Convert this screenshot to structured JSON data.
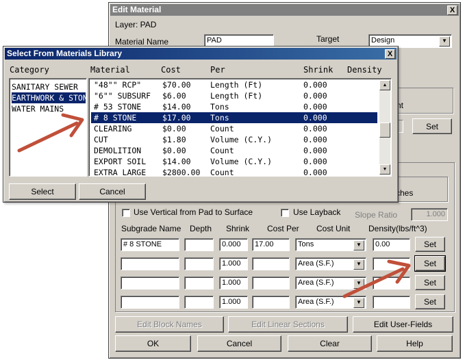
{
  "edit_dialog": {
    "title": "Edit Material",
    "close_glyph": "X",
    "layer_label": "Layer: PAD",
    "material_name_label": "Material Name",
    "material_name_value": "PAD",
    "target_label": "Target",
    "target_value": "Design",
    "partial_label_1": "nt",
    "set_label": "Set",
    "partial_label_2": "ches",
    "use_vertical_label": "Use Vertical from Pad to Surface",
    "use_layback_label": "Use Layback",
    "slope_ratio_label": "Slope Ratio",
    "slope_ratio_value": "1.000",
    "subgrade_headers": {
      "name": "Subgrade Name",
      "depth": "Depth",
      "shrink": "Shrink",
      "cost_per": "Cost Per",
      "cost_unit": "Cost Unit",
      "density": "Density(lbs/ft^3)"
    },
    "subgrade_rows": [
      {
        "name": "# 8 STONE",
        "depth": "",
        "shrink": "0.000",
        "cost": "17.00",
        "unit": "Tons",
        "density": "0.00",
        "set": "Set"
      },
      {
        "name": "",
        "depth": "",
        "shrink": "1.000",
        "cost": "",
        "unit": "Area (S.F.)",
        "density": "",
        "set": "Set"
      },
      {
        "name": "",
        "depth": "",
        "shrink": "1.000",
        "cost": "",
        "unit": "Area (S.F.)",
        "density": "",
        "set": "Set"
      },
      {
        "name": "",
        "depth": "",
        "shrink": "1.000",
        "cost": "",
        "unit": "Area (S.F.)",
        "density": "",
        "set": "Set"
      }
    ],
    "edit_block_names": "Edit Block Names",
    "edit_linear_sections": "Edit Linear Sections",
    "edit_user_fields": "Edit User-Fields",
    "ok": "OK",
    "cancel": "Cancel",
    "clear": "Clear",
    "help": "Help"
  },
  "library_dialog": {
    "title": "Select From Materials Library",
    "close_glyph": "X",
    "headers": {
      "category": "Category",
      "material": "Material",
      "cost": "Cost",
      "per": "Per",
      "shrink": "Shrink",
      "density": "Density"
    },
    "categories": [
      "SANITARY SEWER",
      "EARTHWORK & STONE",
      "WATER MAINS"
    ],
    "materials": [
      {
        "material": "\"48\"\" RCP\"",
        "cost": "$70.00",
        "per": "Length (Ft)",
        "shrink": "0.000"
      },
      {
        "material": "\"6\"\" SUBSURF",
        "cost": "$6.00",
        "per": "Length (Ft)",
        "shrink": "0.000"
      },
      {
        "material": "# 53 STONE",
        "cost": "$14.00",
        "per": "Tons",
        "shrink": "0.000"
      },
      {
        "material": "# 8 STONE",
        "cost": "$17.00",
        "per": "Tons",
        "shrink": "0.000"
      },
      {
        "material": "CLEARING",
        "cost": "$0.00",
        "per": "Count",
        "shrink": "0.000"
      },
      {
        "material": "CUT",
        "cost": "$1.80",
        "per": "Volume (C.Y.)",
        "shrink": "0.000"
      },
      {
        "material": "DEMOLITION",
        "cost": "$0.00",
        "per": "Count",
        "shrink": "0.000"
      },
      {
        "material": "EXPORT SOIL",
        "cost": "$14.00",
        "per": "Volume (C.Y.)",
        "shrink": "0.000"
      },
      {
        "material": "EXTRA LARGE",
        "cost": "$2800.00",
        "per": "Count",
        "shrink": "0.000"
      }
    ],
    "select_button": "Select",
    "cancel_button": "Cancel"
  },
  "colors": {
    "dialog_bg": "#d4d0c8",
    "selection": "#0a246a",
    "arrow": "#c0503a"
  }
}
